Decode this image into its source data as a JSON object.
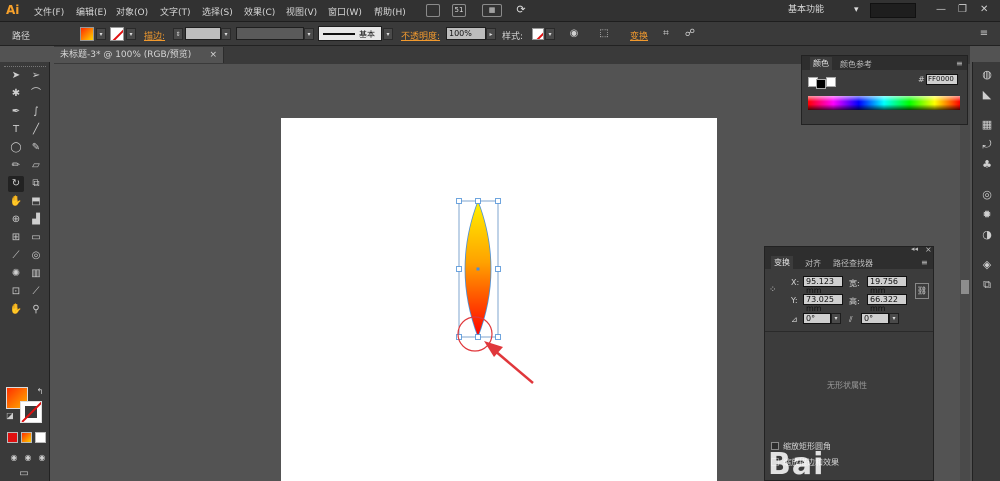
{
  "app": {
    "logo": "Ai"
  },
  "menu": [
    "文件(F)",
    "编辑(E)",
    "对象(O)",
    "文字(T)",
    "选择(S)",
    "效果(C)",
    "视图(V)",
    "窗口(W)",
    "帮助(H)"
  ],
  "menubar": {
    "icon_st": "St",
    "icon_51": "51",
    "workspace": "基本功能",
    "workspace_arrow": "▾"
  },
  "control": {
    "selection_label": "路径",
    "stroke_label": "描边:",
    "stroke_style": "基本",
    "opacity_label": "不透明度:",
    "opacity_value": "100%",
    "style_label": "样式:",
    "transform_label": "变换"
  },
  "document": {
    "tab_title": "未标题-3* @ 100% (RGB/预览)",
    "close": "×"
  },
  "color_panel": {
    "tab_color": "颜色",
    "tab_guide": "颜色参考",
    "hash": "#",
    "hex": "FF0000"
  },
  "transform_panel": {
    "tabs": [
      "变换",
      "对齐",
      "路径查找器"
    ],
    "x_label": "X:",
    "x_value": "95.123 mm",
    "y_label": "Y:",
    "y_value": "73.025 mm",
    "w_label": "宽:",
    "w_value": "19.756 mm",
    "h_label": "高:",
    "h_value": "66.322 mm",
    "rotate_value": "0°",
    "shear_value": "0°",
    "no_shape": "无形状属性",
    "scale_corners": "缩放矩形圆角",
    "scale_strokes": "缩放描边和效果"
  },
  "colors": {
    "accent": "#f29a2e",
    "grad_top": "#ffe000",
    "grad_bottom": "#ff0000",
    "arrow": "#e0373b"
  },
  "watermark": "Bai"
}
